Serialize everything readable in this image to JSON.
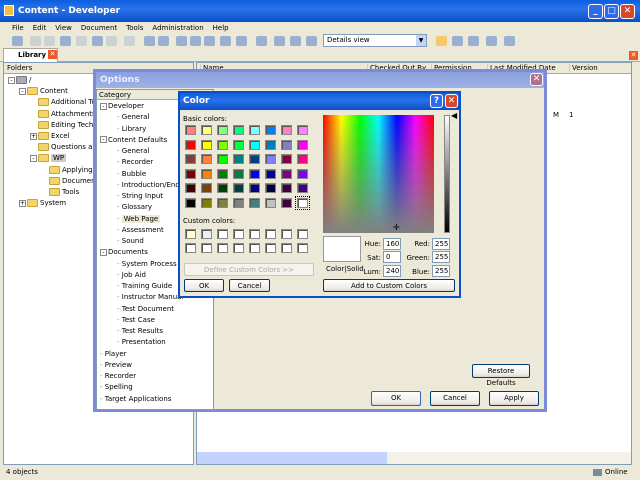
{
  "window": {
    "title": "Content - Developer"
  },
  "menu": [
    "File",
    "Edit",
    "View",
    "Document",
    "Tools",
    "Administration",
    "Help"
  ],
  "toolbar": {
    "view_select": "Details view"
  },
  "tab": {
    "label": "Library"
  },
  "folders": {
    "header": "Folders",
    "items": [
      {
        "label": "/",
        "indent": 0,
        "exp": "-"
      },
      {
        "label": "Content",
        "indent": 1,
        "exp": "-"
      },
      {
        "label": "Additional Top",
        "indent": 2,
        "exp": ""
      },
      {
        "label": "Attachments",
        "indent": 2,
        "exp": ""
      },
      {
        "label": "Editing Techni",
        "indent": 2,
        "exp": ""
      },
      {
        "label": "Excel",
        "indent": 2,
        "exp": "+"
      },
      {
        "label": "Questions and",
        "indent": 2,
        "exp": ""
      },
      {
        "label": "WP",
        "indent": 2,
        "exp": "-"
      },
      {
        "label": "Applying F",
        "indent": 3,
        "exp": ""
      },
      {
        "label": "Document",
        "indent": 3,
        "exp": ""
      },
      {
        "label": "Tools",
        "indent": 3,
        "exp": ""
      },
      {
        "label": "System",
        "indent": 1,
        "exp": "+"
      }
    ]
  },
  "list": {
    "columns": [
      "Name",
      "Checked Out By",
      "Permission",
      "Last Modified Date",
      "Version"
    ],
    "row_fragment": [
      "M",
      "1"
    ]
  },
  "status": {
    "left": "4 objects",
    "right": "Online"
  },
  "options": {
    "title": "Options",
    "category_header": "Category",
    "tree": [
      {
        "label": "Developer",
        "level": 0
      },
      {
        "label": "General",
        "level": 1
      },
      {
        "label": "Library",
        "level": 1
      },
      {
        "label": "Content Defaults",
        "level": 0
      },
      {
        "label": "General",
        "level": 1
      },
      {
        "label": "Recorder",
        "level": 1
      },
      {
        "label": "Bubble",
        "level": 1
      },
      {
        "label": "Introduction/End Fr",
        "level": 1
      },
      {
        "label": "String Input",
        "level": 1
      },
      {
        "label": "Glossary",
        "level": 1
      },
      {
        "label": "Web Page",
        "level": 1,
        "selected": true
      },
      {
        "label": "Assessment",
        "level": 1
      },
      {
        "label": "Sound",
        "level": 1
      },
      {
        "label": "Documents",
        "level": 0
      },
      {
        "label": "System Process",
        "level": 1
      },
      {
        "label": "Job Aid",
        "level": 1
      },
      {
        "label": "Training Guide",
        "level": 1
      },
      {
        "label": "Instructor Manual",
        "level": 1
      },
      {
        "label": "Test Document",
        "level": 1
      },
      {
        "label": "Test Case",
        "level": 1
      },
      {
        "label": "Test Results",
        "level": 1
      },
      {
        "label": "Presentation",
        "level": 1
      },
      {
        "label": "Player",
        "level": 0
      },
      {
        "label": "Preview",
        "level": 0
      },
      {
        "label": "Recorder",
        "level": 0
      },
      {
        "label": "Spelling",
        "level": 0
      },
      {
        "label": "Target Applications",
        "level": 0
      }
    ],
    "restore": "Restore Defaults",
    "ok": "OK",
    "cancel": "Cancel",
    "apply": "Apply"
  },
  "color": {
    "title": "Color",
    "basic_label": "Basic colors:",
    "custom_label": "Custom colors:",
    "basic": [
      "#FF8080",
      "#FFFF80",
      "#80FF80",
      "#00FF80",
      "#80FFFF",
      "#0080FF",
      "#FF80C0",
      "#FF80FF",
      "#FF0000",
      "#FFFF00",
      "#80FF00",
      "#00FF40",
      "#00FFFF",
      "#0080C0",
      "#8080C0",
      "#FF00FF",
      "#804040",
      "#FF8040",
      "#00FF00",
      "#008080",
      "#004080",
      "#8080FF",
      "#800040",
      "#FF0080",
      "#800000",
      "#FF8000",
      "#008000",
      "#008040",
      "#0000FF",
      "#0000A0",
      "#800080",
      "#8000FF",
      "#400000",
      "#804000",
      "#004000",
      "#004040",
      "#000080",
      "#000040",
      "#400040",
      "#400080",
      "#000000",
      "#808000",
      "#808040",
      "#808080",
      "#408080",
      "#C0C0C0",
      "#400040",
      "#FFFFFF"
    ],
    "custom": [
      "#FFFFC0",
      "#E8F0F0",
      "#FFFFFF",
      "#FFFFFF",
      "#FFFFFF",
      "#FFFFFF",
      "#FFFFFF",
      "#FFFFFF",
      "#FFFFFF",
      "#FFFFFF",
      "#FFFFFF",
      "#FFFFFF",
      "#FFFFFF",
      "#FFFFFF",
      "#FFFFFF",
      "#FFFFFF"
    ],
    "define": "Define Custom Colors >>",
    "ok": "OK",
    "cancel": "Cancel",
    "add": "Add to Custom Colors",
    "preview_label": "Color|Solid",
    "hue_label": "Hue:",
    "hue": "160",
    "sat_label": "Sat:",
    "sat": "0",
    "lum_label": "Lum:",
    "lum": "240",
    "red_label": "Red:",
    "red": "255",
    "green_label": "Green:",
    "green": "255",
    "blue_label": "Blue:",
    "blue": "255"
  }
}
